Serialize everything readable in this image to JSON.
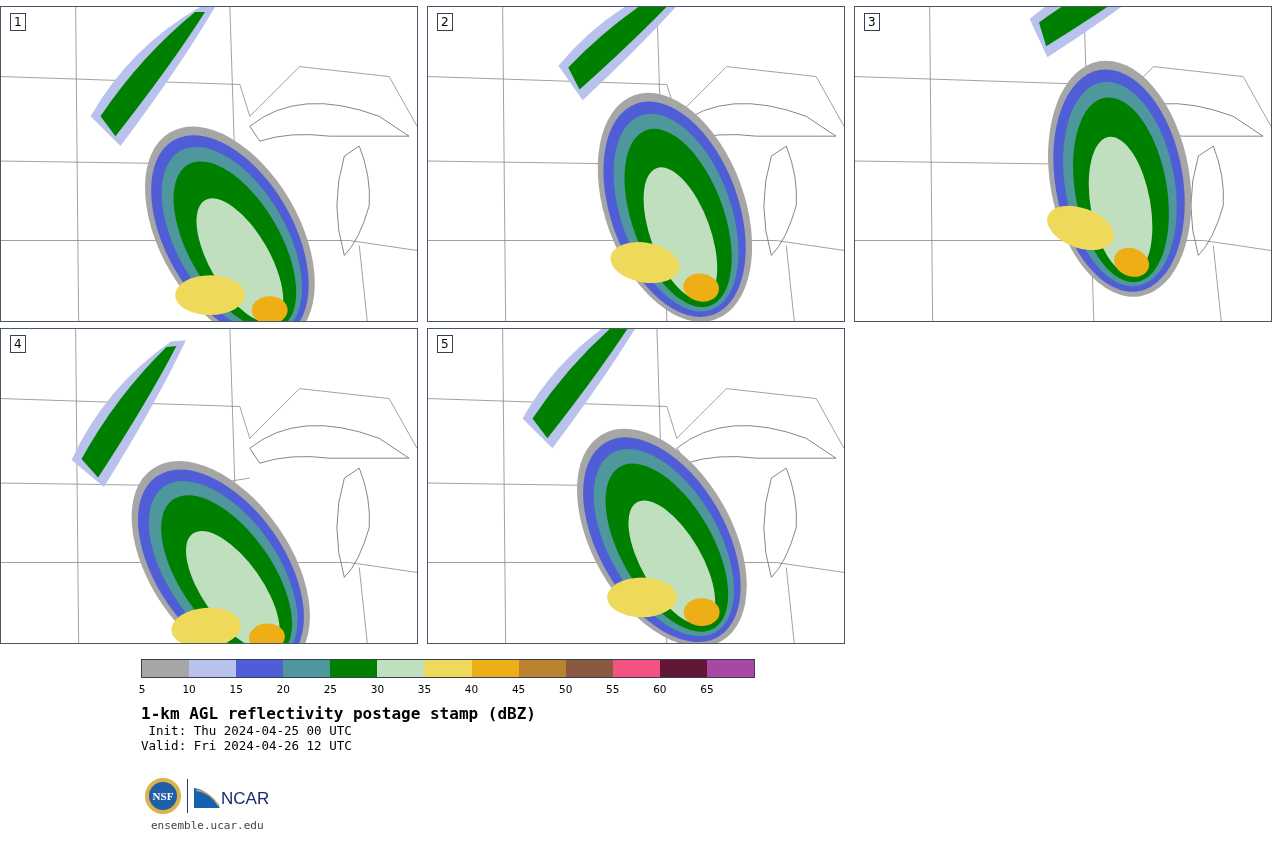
{
  "panels": [
    {
      "number": "1"
    },
    {
      "number": "2"
    },
    {
      "number": "3"
    },
    {
      "number": "4"
    },
    {
      "number": "5"
    }
  ],
  "colorbar": {
    "bins": [
      {
        "color": "#a6a6a6"
      },
      {
        "color": "#b8c2ec"
      },
      {
        "color": "#4f5ed6"
      },
      {
        "color": "#4e979c"
      },
      {
        "color": "#008000"
      },
      {
        "color": "#bfdfbf"
      },
      {
        "color": "#efd95a"
      },
      {
        "color": "#eeae16"
      },
      {
        "color": "#bb8330"
      },
      {
        "color": "#8b5940"
      },
      {
        "color": "#f45280"
      },
      {
        "color": "#621736"
      },
      {
        "color": "#a948a4"
      }
    ],
    "ticks": [
      "5",
      "10",
      "15",
      "20",
      "25",
      "30",
      "35",
      "40",
      "45",
      "50",
      "55",
      "60",
      "65"
    ]
  },
  "title": "1-km AGL reflectivity postage stamp (dBZ)",
  "init": " Init: Thu 2024-04-25 00 UTC",
  "valid": "Valid: Fri 2024-04-26 12 UTC",
  "logos": {
    "nsf": "NSF",
    "ncar": "NCAR"
  },
  "url": "ensemble.ucar.edu"
}
